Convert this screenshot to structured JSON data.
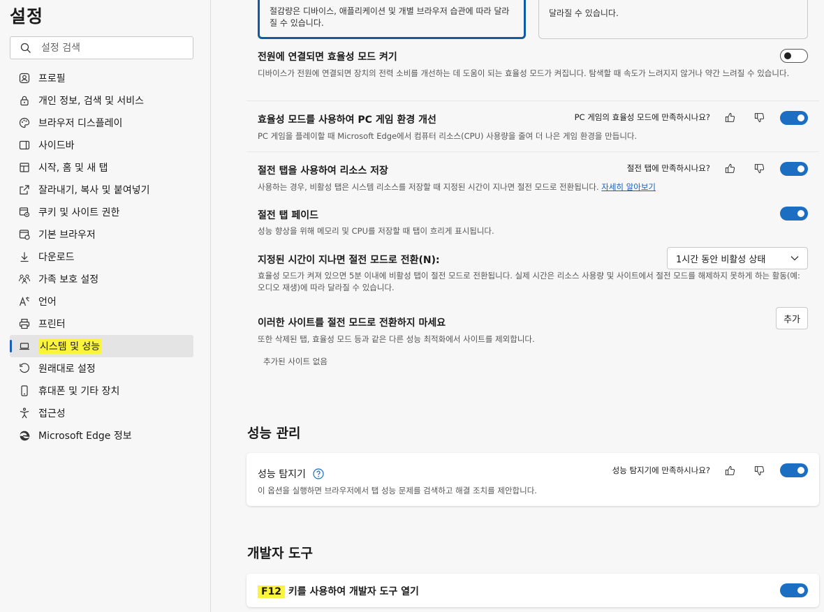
{
  "sidebar": {
    "title": "설정",
    "search_placeholder": "설정 검색",
    "items": [
      {
        "label": "프로필",
        "icon": "profile-icon"
      },
      {
        "label": "개인 정보, 검색 및 서비스",
        "icon": "lock-icon"
      },
      {
        "label": "브라우저 디스플레이",
        "icon": "palette-icon"
      },
      {
        "label": "사이드바",
        "icon": "sidebar-icon"
      },
      {
        "label": "시작, 홈 및 새 탭",
        "icon": "home-icon"
      },
      {
        "label": "잘라내기, 복사 및 붙여넣기",
        "icon": "share-icon"
      },
      {
        "label": "쿠키 및 사이트 권한",
        "icon": "cookie-icon"
      },
      {
        "label": "기본 브라우저",
        "icon": "browser-icon"
      },
      {
        "label": "다운로드",
        "icon": "download-icon"
      },
      {
        "label": "가족 보호 설정",
        "icon": "family-icon"
      },
      {
        "label": "언어",
        "icon": "language-icon"
      },
      {
        "label": "프린터",
        "icon": "printer-icon"
      },
      {
        "label": "시스템 및 성능",
        "icon": "laptop-icon"
      },
      {
        "label": "원래대로 설정",
        "icon": "reset-icon"
      },
      {
        "label": "휴대폰 및 기타 장치",
        "icon": "phone-icon"
      },
      {
        "label": "접근성",
        "icon": "accessibility-icon"
      },
      {
        "label": "Microsoft Edge 정보",
        "icon": "edge-icon"
      }
    ],
    "active_index": 12
  },
  "efficiency": {
    "option_left_desc": "절감량은 디바이스, 애플리케이션 및 개별 브라우저 습관에 따라 달라질 수 있습니다.",
    "option_right_desc": "달라질 수 있습니다.",
    "power_title": "전원에 연결되면 효율성 모드 켜기",
    "power_desc": "디바이스가 전원에 연결되면 장치의 전력 소비를 개선하는 데 도움이 되는 효율성 모드가 켜집니다. 탐색할 때 속도가 느려지지 않거나 약간 느려질 수 있습니다.",
    "power_on": false,
    "game_title": "효율성 모드를 사용하여 PC 게임 환경 개선",
    "game_feedback": "PC 게임의 효율성 모드에 만족하시나요?",
    "game_desc": "PC 게임을 플레이할 때 Microsoft Edge에서 컴퓨터 리소스(CPU) 사용량을 줄여 더 나은 게임 환경을 만듭니다.",
    "game_on": true,
    "sleep_title": "절전 탭을 사용하여 리소스 저장",
    "sleep_feedback": "절전 탭에 만족하시나요?",
    "sleep_desc": "사용하는 경우, 비활성 탭은 시스템 리소스를 저장할 때 지정된 시간이 지나면 절전 모드로 전환됩니다.",
    "sleep_link": "자세히 알아보기",
    "sleep_on": true,
    "fade_title": "절전 탭 페이드",
    "fade_desc": "성능 향상을 위해 메모리 및 CPU를 저장할 때 탭이 흐리게 표시됩니다.",
    "fade_on": true,
    "timeout_title": "지정된 시간이 지나면 절전 모드로 전환(N):",
    "timeout_value": "1시간 동안 비활성 상태",
    "timeout_desc": "효율성 모드가 켜져 있으면 5분 이내에 비활성 탭이 절전 모드로 전환됩니다. 실제 시간은 리소스 사용량 및 사이트에서 절전 모드를 해제하지 못하게 하는 활동(예: 오디오 재생)에 따라 달라질 수 있습니다.",
    "never_title": "이러한 사이트를 절전 모드로 전환하지 마세요",
    "never_desc": "또한 삭제된 탭, 효율성 모드 등과 같은 다른 성능 최적화에서 사이트를 제외합니다.",
    "add_label": "추가",
    "no_sites": "추가된 사이트 없음"
  },
  "performance": {
    "heading": "성능 관리",
    "detector_title": "성능 탐지기",
    "detector_feedback": "성능 탐지기에 만족하시나요?",
    "detector_desc": "이 옵션을 실행하면 브라우저에서 탭 성능 문제를 검색하고 해결 조치를 제안합니다.",
    "detector_on": true
  },
  "devtools": {
    "heading": "개발자 도구",
    "f12_key": "F12",
    "f12_rest": " 키를 사용하여 개발자 도구 열기",
    "f12_on": true
  },
  "colors": {
    "accent": "#1b6ec2",
    "highlight": "#fbf43c",
    "active_bar": "#1a5fb4"
  }
}
